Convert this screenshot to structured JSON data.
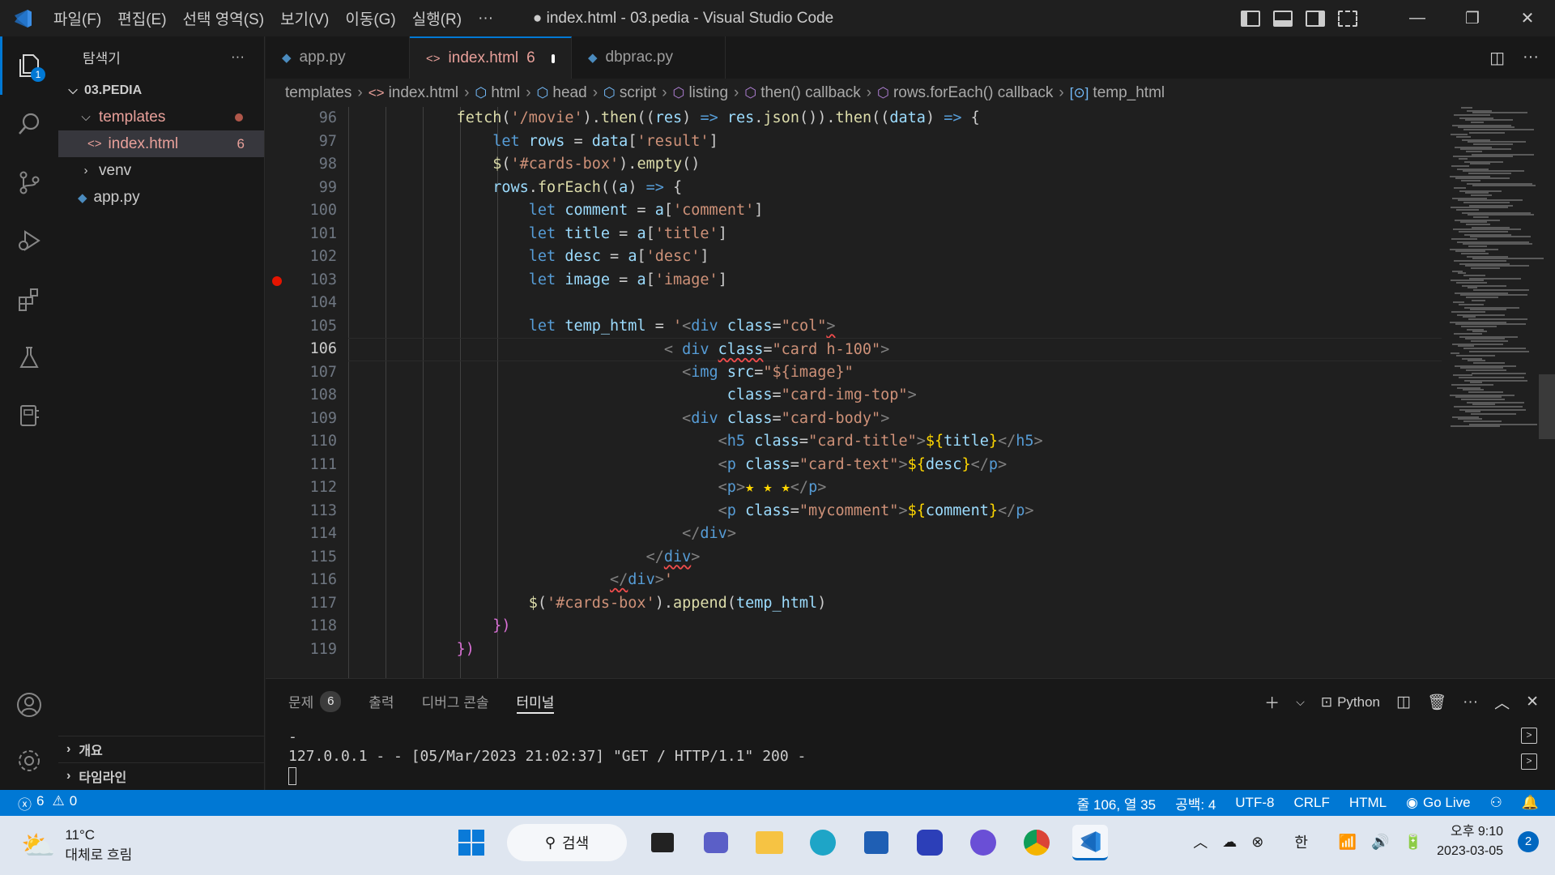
{
  "window": {
    "title": "● index.html - 03.pedia - Visual Studio Code",
    "menu": [
      "파일(F)",
      "편집(E)",
      "선택 영역(S)",
      "보기(V)",
      "이동(G)",
      "실행(R)",
      "···"
    ]
  },
  "activity": {
    "explorer_badge": "1"
  },
  "sidebar": {
    "header": "탐색기",
    "more": "···",
    "root": "03.PEDIA",
    "folder_templates": "templates",
    "file_index": "index.html",
    "file_index_count": "6",
    "folder_venv": "venv",
    "file_app": "app.py",
    "outline": "개요",
    "timeline": "타임라인"
  },
  "tabs": [
    {
      "label": "app.py"
    },
    {
      "label": "index.html",
      "problems": "6"
    },
    {
      "label": "dbprac.py"
    }
  ],
  "breadcrumb": [
    "templates",
    "index.html",
    "html",
    "head",
    "script",
    "listing",
    "then() callback",
    "rows.forEach() callback",
    "temp_html"
  ],
  "editor": {
    "line_numbers": [
      "96",
      "97",
      "98",
      "99",
      "100",
      "101",
      "102",
      "103",
      "104",
      "105",
      "106",
      "107",
      "108",
      "109",
      "110",
      "111",
      "112",
      "113",
      "114",
      "115",
      "116",
      "117",
      "118",
      "119"
    ],
    "breakpoint_line": "103",
    "current_line": "106"
  },
  "panel": {
    "tabs": [
      "문제",
      "출력",
      "디버그 콘솔",
      "터미널"
    ],
    "problems_count": "6",
    "terminal_profile": "Python",
    "terminal_lines": [
      "-",
      "127.0.0.1 - - [05/Mar/2023 21:02:37] \"GET / HTTP/1.1\" 200 -"
    ]
  },
  "status": {
    "errors": "6",
    "warnings": "0",
    "position": "줄 106, 열 35",
    "spaces": "공백: 4",
    "encoding": "UTF-8",
    "eol": "CRLF",
    "language": "HTML",
    "golive": "Go Live"
  },
  "taskbar": {
    "temp": "11°C",
    "weather_desc": "대체로 흐림",
    "search": "검색",
    "ime": "한",
    "time": "오후 9:10",
    "date": "2023-03-05",
    "notifications": "2"
  },
  "colors": {
    "accent": "#0078d4",
    "statusbar": "#0078d4",
    "modified": "#e8a09a"
  }
}
